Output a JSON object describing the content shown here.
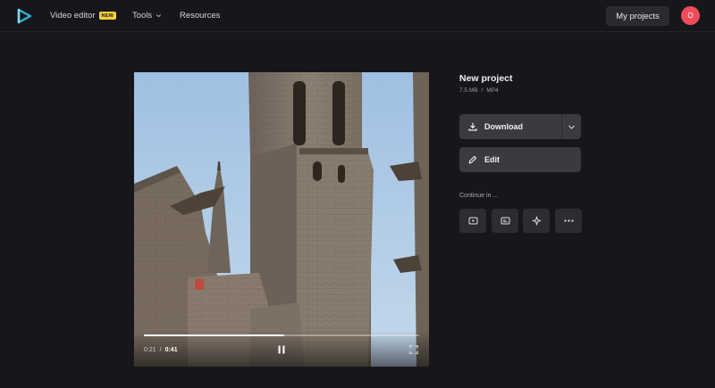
{
  "header": {
    "nav": [
      {
        "label": "Video editor",
        "badge": "NEW"
      },
      {
        "label": "Tools"
      },
      {
        "label": "Resources"
      }
    ],
    "my_projects_label": "My projects",
    "avatar_initial": "O"
  },
  "player": {
    "current_time": "0:21",
    "separator": "/",
    "total_time": "0:41",
    "progress_fraction": 0.51,
    "icons": [
      "pause-icon",
      "fullscreen-icon"
    ]
  },
  "project": {
    "title": "New project",
    "size": "7.5 MB",
    "meta_separator": "/",
    "format": "MP4"
  },
  "actions": {
    "download_label": "Download",
    "edit_label": "Edit"
  },
  "continue_in": {
    "label": "Continue in ...",
    "tools": [
      "video-player-icon",
      "subtitles-icon",
      "sparkle-icon",
      "more-icon"
    ]
  },
  "colors": {
    "background": "#17171b",
    "button": "#3a3a40",
    "accent_avatar": "#ef4c5a",
    "badge": "#f3cf3a",
    "logo": "#3ab0d6"
  }
}
